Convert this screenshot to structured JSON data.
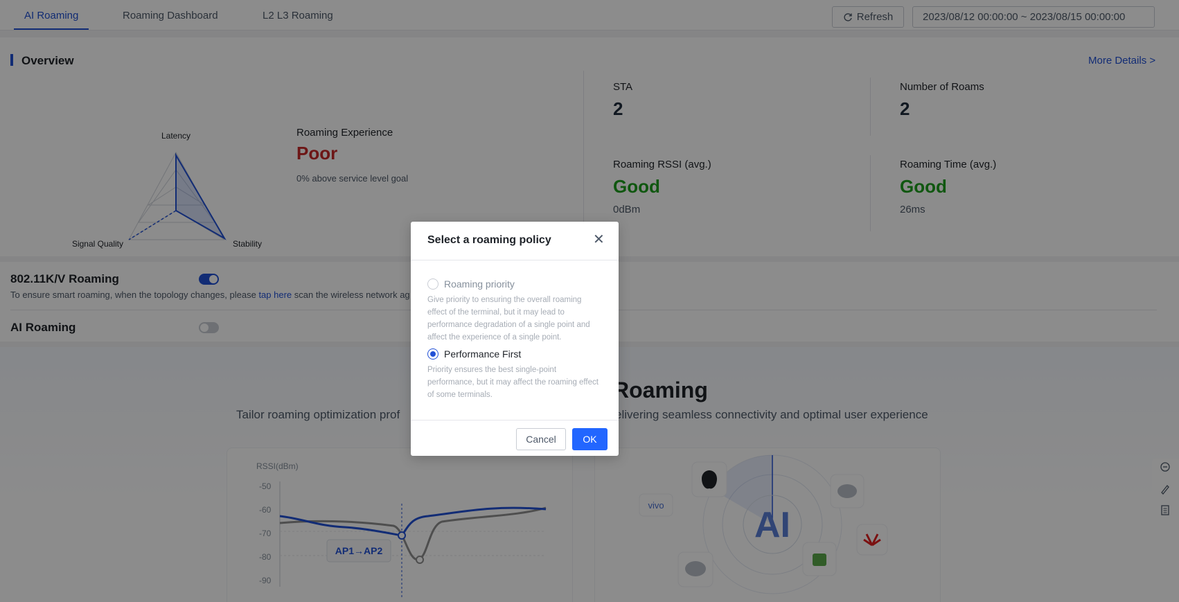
{
  "tabs": [
    {
      "label": "AI Roaming",
      "active": true
    },
    {
      "label": "Roaming Dashboard",
      "active": false
    },
    {
      "label": "L2 L3 Roaming",
      "active": false
    }
  ],
  "toolbar": {
    "refresh_label": "Refresh",
    "date_range": "2023/08/12 00:00:00 ~ 2023/08/15 00:00:00"
  },
  "overview": {
    "title": "Overview",
    "more_details": "More Details >",
    "radar_axes": {
      "top": "Latency",
      "left": "Signal Quality",
      "right": "Stability"
    },
    "experience": {
      "label": "Roaming Experience",
      "value": "Poor",
      "subtext": "0% above service level goal"
    },
    "stats": {
      "sta": {
        "label": "STA",
        "value": "2"
      },
      "roams": {
        "label": "Number of Roams",
        "value": "2"
      },
      "rssi": {
        "label": "Roaming RSSI (avg.)",
        "value": "Good",
        "sub": "0dBm"
      },
      "time": {
        "label": "Roaming Time (avg.)",
        "value": "Good",
        "sub": "26ms"
      }
    }
  },
  "roaming": {
    "kv_title": "802.11K/V Roaming",
    "kv_enabled": true,
    "desc_before": "To ensure smart roaming, when the topology changes, please ",
    "desc_link": "tap here",
    "desc_after": " scan the wireless network ag",
    "ai_title": "AI Roaming",
    "ai_enabled": false
  },
  "hero": {
    "title": "Roaming",
    "subtitle_left": "Tailor roaming optimization prof",
    "subtitle_right": "elivering seamless connectivity and optimal user experience"
  },
  "rssi_chart": {
    "ylabel": "RSSI(dBm)",
    "yticks": [
      "-50",
      "-60",
      "-70",
      "-80",
      "-90"
    ],
    "badge": "AP1→AP2"
  },
  "ai_card": {
    "center_text": "AI",
    "brand_vivo": "vivo"
  },
  "modal": {
    "title": "Select a roaming policy",
    "options": [
      {
        "label": "Roaming priority",
        "desc": "Give priority to ensuring the overall roaming effect of the terminal, but it may lead to performance degradation of a single point and affect the experience of a single point.",
        "checked": false
      },
      {
        "label": "Performance First",
        "desc": "Priority ensures the best single-point performance, but it may affect the roaming effect of some terminals.",
        "checked": true
      }
    ],
    "cancel_label": "Cancel",
    "ok_label": "OK"
  },
  "colors": {
    "accent": "#2251d6",
    "poor": "#c62828",
    "good": "#1e9e1e",
    "ok_button": "#2266ff"
  }
}
